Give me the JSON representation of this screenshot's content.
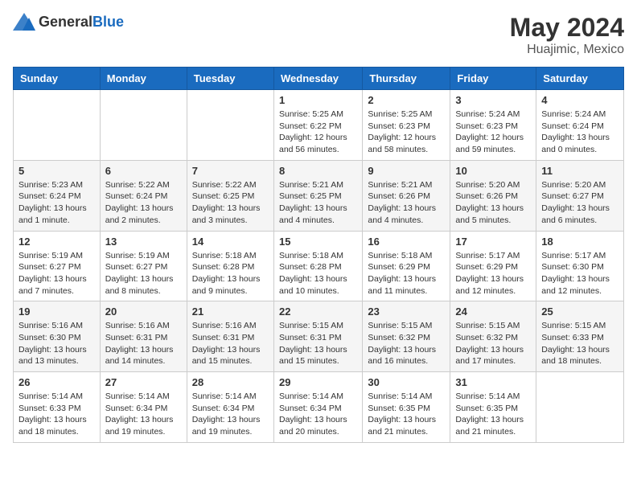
{
  "header": {
    "logo_general": "General",
    "logo_blue": "Blue",
    "month": "May 2024",
    "location": "Huajimic, Mexico"
  },
  "weekdays": [
    "Sunday",
    "Monday",
    "Tuesday",
    "Wednesday",
    "Thursday",
    "Friday",
    "Saturday"
  ],
  "weeks": [
    [
      {
        "day": "",
        "info": ""
      },
      {
        "day": "",
        "info": ""
      },
      {
        "day": "",
        "info": ""
      },
      {
        "day": "1",
        "info": "Sunrise: 5:25 AM\nSunset: 6:22 PM\nDaylight: 12 hours\nand 56 minutes."
      },
      {
        "day": "2",
        "info": "Sunrise: 5:25 AM\nSunset: 6:23 PM\nDaylight: 12 hours\nand 58 minutes."
      },
      {
        "day": "3",
        "info": "Sunrise: 5:24 AM\nSunset: 6:23 PM\nDaylight: 12 hours\nand 59 minutes."
      },
      {
        "day": "4",
        "info": "Sunrise: 5:24 AM\nSunset: 6:24 PM\nDaylight: 13 hours\nand 0 minutes."
      }
    ],
    [
      {
        "day": "5",
        "info": "Sunrise: 5:23 AM\nSunset: 6:24 PM\nDaylight: 13 hours\nand 1 minute."
      },
      {
        "day": "6",
        "info": "Sunrise: 5:22 AM\nSunset: 6:24 PM\nDaylight: 13 hours\nand 2 minutes."
      },
      {
        "day": "7",
        "info": "Sunrise: 5:22 AM\nSunset: 6:25 PM\nDaylight: 13 hours\nand 3 minutes."
      },
      {
        "day": "8",
        "info": "Sunrise: 5:21 AM\nSunset: 6:25 PM\nDaylight: 13 hours\nand 4 minutes."
      },
      {
        "day": "9",
        "info": "Sunrise: 5:21 AM\nSunset: 6:26 PM\nDaylight: 13 hours\nand 4 minutes."
      },
      {
        "day": "10",
        "info": "Sunrise: 5:20 AM\nSunset: 6:26 PM\nDaylight: 13 hours\nand 5 minutes."
      },
      {
        "day": "11",
        "info": "Sunrise: 5:20 AM\nSunset: 6:27 PM\nDaylight: 13 hours\nand 6 minutes."
      }
    ],
    [
      {
        "day": "12",
        "info": "Sunrise: 5:19 AM\nSunset: 6:27 PM\nDaylight: 13 hours\nand 7 minutes."
      },
      {
        "day": "13",
        "info": "Sunrise: 5:19 AM\nSunset: 6:27 PM\nDaylight: 13 hours\nand 8 minutes."
      },
      {
        "day": "14",
        "info": "Sunrise: 5:18 AM\nSunset: 6:28 PM\nDaylight: 13 hours\nand 9 minutes."
      },
      {
        "day": "15",
        "info": "Sunrise: 5:18 AM\nSunset: 6:28 PM\nDaylight: 13 hours\nand 10 minutes."
      },
      {
        "day": "16",
        "info": "Sunrise: 5:18 AM\nSunset: 6:29 PM\nDaylight: 13 hours\nand 11 minutes."
      },
      {
        "day": "17",
        "info": "Sunrise: 5:17 AM\nSunset: 6:29 PM\nDaylight: 13 hours\nand 12 minutes."
      },
      {
        "day": "18",
        "info": "Sunrise: 5:17 AM\nSunset: 6:30 PM\nDaylight: 13 hours\nand 12 minutes."
      }
    ],
    [
      {
        "day": "19",
        "info": "Sunrise: 5:16 AM\nSunset: 6:30 PM\nDaylight: 13 hours\nand 13 minutes."
      },
      {
        "day": "20",
        "info": "Sunrise: 5:16 AM\nSunset: 6:31 PM\nDaylight: 13 hours\nand 14 minutes."
      },
      {
        "day": "21",
        "info": "Sunrise: 5:16 AM\nSunset: 6:31 PM\nDaylight: 13 hours\nand 15 minutes."
      },
      {
        "day": "22",
        "info": "Sunrise: 5:15 AM\nSunset: 6:31 PM\nDaylight: 13 hours\nand 15 minutes."
      },
      {
        "day": "23",
        "info": "Sunrise: 5:15 AM\nSunset: 6:32 PM\nDaylight: 13 hours\nand 16 minutes."
      },
      {
        "day": "24",
        "info": "Sunrise: 5:15 AM\nSunset: 6:32 PM\nDaylight: 13 hours\nand 17 minutes."
      },
      {
        "day": "25",
        "info": "Sunrise: 5:15 AM\nSunset: 6:33 PM\nDaylight: 13 hours\nand 18 minutes."
      }
    ],
    [
      {
        "day": "26",
        "info": "Sunrise: 5:14 AM\nSunset: 6:33 PM\nDaylight: 13 hours\nand 18 minutes."
      },
      {
        "day": "27",
        "info": "Sunrise: 5:14 AM\nSunset: 6:34 PM\nDaylight: 13 hours\nand 19 minutes."
      },
      {
        "day": "28",
        "info": "Sunrise: 5:14 AM\nSunset: 6:34 PM\nDaylight: 13 hours\nand 19 minutes."
      },
      {
        "day": "29",
        "info": "Sunrise: 5:14 AM\nSunset: 6:34 PM\nDaylight: 13 hours\nand 20 minutes."
      },
      {
        "day": "30",
        "info": "Sunrise: 5:14 AM\nSunset: 6:35 PM\nDaylight: 13 hours\nand 21 minutes."
      },
      {
        "day": "31",
        "info": "Sunrise: 5:14 AM\nSunset: 6:35 PM\nDaylight: 13 hours\nand 21 minutes."
      },
      {
        "day": "",
        "info": ""
      }
    ]
  ]
}
